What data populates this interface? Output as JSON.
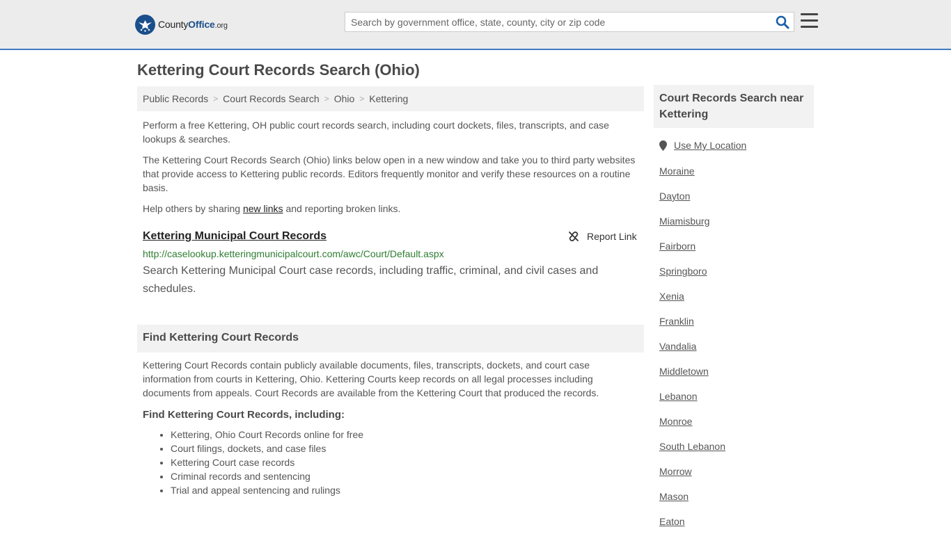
{
  "header": {
    "logo_brand": "County",
    "logo_brand2": "Office",
    "logo_tld": ".org",
    "search_placeholder": "Search by government office, state, county, city or zip code"
  },
  "page": {
    "title": "Kettering Court Records Search (Ohio)"
  },
  "breadcrumb": [
    "Public Records",
    "Court Records Search",
    "Ohio",
    "Kettering"
  ],
  "intro": {
    "p1": "Perform a free Kettering, OH public court records search, including court dockets, files, transcripts, and case lookups & searches.",
    "p2": "The Kettering Court Records Search (Ohio) links below open in a new window and take you to third party websites that provide access to Kettering public records. Editors frequently monitor and verify these resources on a routine basis.",
    "p3_before": "Help others by sharing ",
    "p3_link": "new links",
    "p3_after": " and reporting broken links."
  },
  "record": {
    "title": "Kettering Municipal Court Records",
    "report_label": "Report Link",
    "url": "http://caselookup.ketteringmunicipalcourt.com/awc/Court/Default.aspx",
    "description": "Search Kettering Municipal Court case records, including traffic, criminal, and civil cases and schedules."
  },
  "find": {
    "heading": "Find Kettering Court Records",
    "paragraph": "Kettering Court Records contain publicly available documents, files, transcripts, dockets, and court case information from courts in Kettering, Ohio. Kettering Courts keep records on all legal processes including documents from appeals. Court Records are available from the Kettering Court that produced the records.",
    "subheading": "Find Kettering Court Records, including:",
    "items": [
      "Kettering, Ohio Court Records online for free",
      "Court filings, dockets, and case files",
      "Kettering Court case records",
      "Criminal records and sentencing",
      "Trial and appeal sentencing and rulings"
    ]
  },
  "sidebar": {
    "heading": "Court Records Search near Kettering",
    "use_location": "Use My Location",
    "cities": [
      "Moraine",
      "Dayton",
      "Miamisburg",
      "Fairborn",
      "Springboro",
      "Xenia",
      "Franklin",
      "Vandalia",
      "Middletown",
      "Lebanon",
      "Monroe",
      "South Lebanon",
      "Morrow",
      "Mason",
      "Eaton"
    ]
  },
  "colors": {
    "accent": "#3f7cc0",
    "brand": "#1a4f8b",
    "url_green": "#2e7d32"
  }
}
